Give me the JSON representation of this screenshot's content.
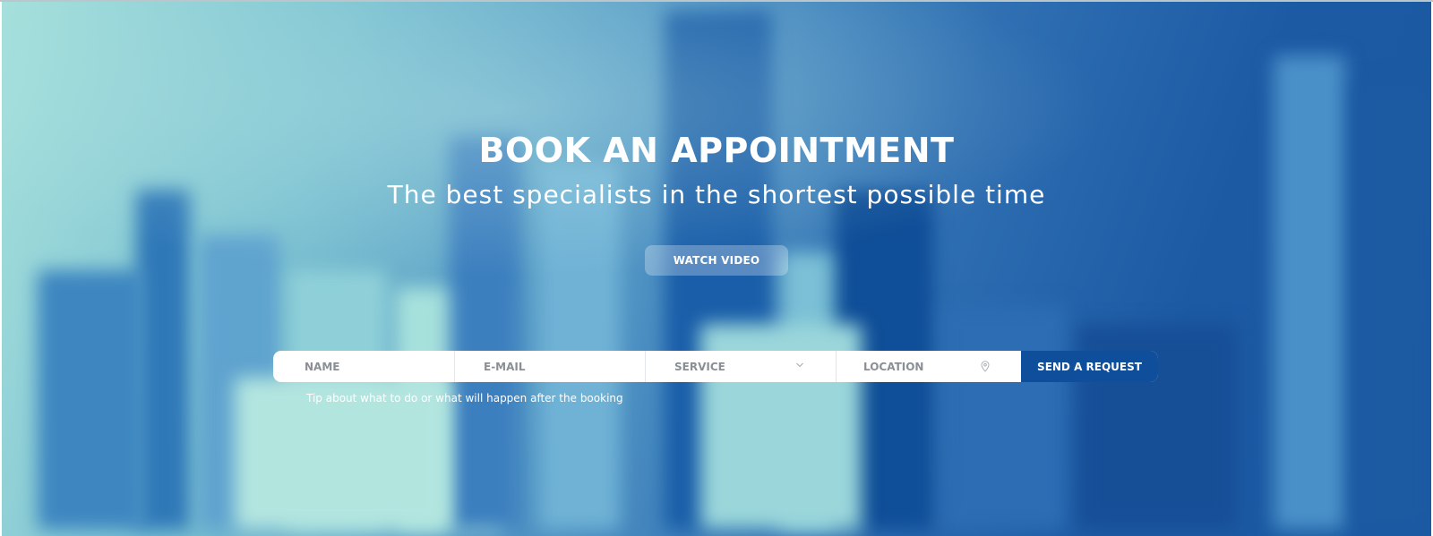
{
  "hero": {
    "title": "BOOK AN APPOINTMENT",
    "subtitle": "The best specialists in the shortest possible time",
    "watch_video_label": "WATCH VIDEO"
  },
  "form": {
    "name_placeholder": "NAME",
    "email_placeholder": "E-MAIL",
    "service_selected": "SERVICE",
    "location_placeholder": "LOCATION",
    "submit_label": "SEND A REQUEST",
    "tip": "Tip about what to do or what will happen after the booking"
  },
  "icons": {
    "service_dropdown": "chevron-down-icon",
    "location": "map-pin-icon"
  },
  "colors": {
    "accent": "#0e4e9b",
    "background_light": "#a6e0dc",
    "background_dark": "#1a5aa2",
    "field_text": "#8a8f96"
  }
}
